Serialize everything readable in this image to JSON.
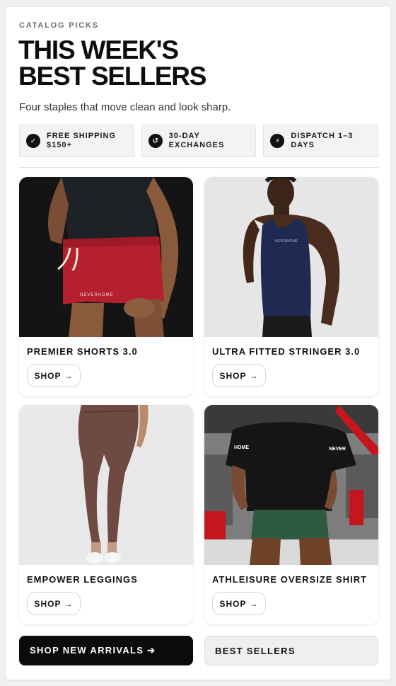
{
  "header": {
    "eyebrow": "CATALOG PICKS",
    "title_line1": "THIS WEEK'S",
    "title_line2": "BEST SELLERS",
    "subtitle": "Four staples that move clean and look sharp."
  },
  "perks": [
    {
      "icon": "check-icon",
      "glyph": "✓",
      "label": "FREE SHIPPING $150+"
    },
    {
      "icon": "exchange-icon",
      "glyph": "↺",
      "label": "30-DAY EXCHANGES"
    },
    {
      "icon": "lightning-icon",
      "glyph": "⚡",
      "label": "DISPATCH 1–3 DAYS"
    }
  ],
  "products": [
    {
      "name": "PREMIER SHORTS 3.0",
      "shop_label": "SHOP →",
      "image_bg": "#141414"
    },
    {
      "name": "ULTRA FITTED STRINGER 3.0",
      "shop_label": "SHOP →",
      "image_bg": "#e6e6e6"
    },
    {
      "name": "EMPOWER LEGGINGS",
      "shop_label": "SHOP →",
      "image_bg": "#e8e8e8"
    },
    {
      "name": "ATHLEISURE OVERSIZE SHIRT",
      "shop_label": "SHOP →",
      "image_bg": "#8a8a8a"
    }
  ],
  "cta": {
    "primary_label": "SHOP NEW ARRIVALS ➔",
    "secondary_label": "BEST SELLERS"
  },
  "colors": {
    "accent": "#0b0b0b",
    "shorts_red": "#b5202e",
    "stringer_navy": "#1f2a52",
    "leggings_brown": "#6e4a43",
    "shorts_green": "#2f5a42"
  }
}
